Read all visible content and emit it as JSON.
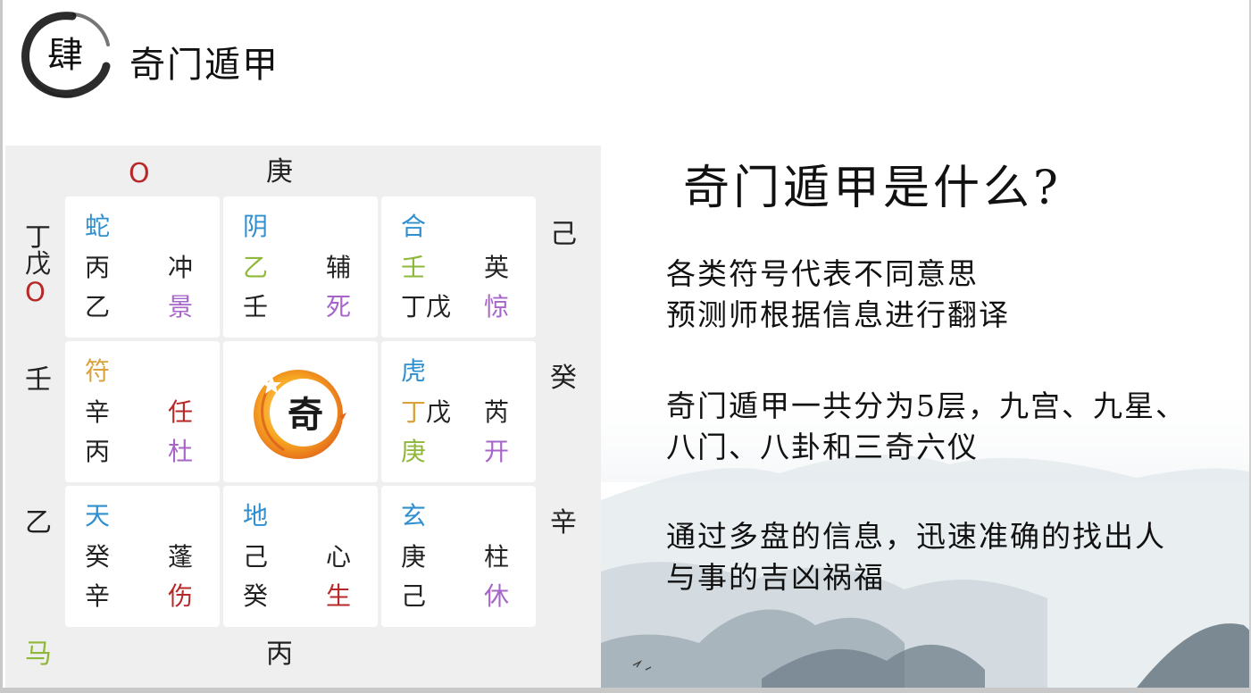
{
  "header": {
    "logo_char": "肆",
    "title": "奇门遁甲"
  },
  "board": {
    "top_left_marker": "O",
    "top_center": "庚",
    "left_top": [
      "丁",
      "戊",
      "O"
    ],
    "left_mid": "壬",
    "left_bottom": "乙",
    "right_top": "己",
    "right_mid": "癸",
    "right_bottom": "辛",
    "bottom_center": "丙",
    "bottom_left_marker": "马",
    "center_logo_char": "奇",
    "palaces": [
      {
        "god": "蛇",
        "s1": "丙",
        "s2": "乙",
        "r1": "冲",
        "r2": "景"
      },
      {
        "god": "阴",
        "s1": "乙",
        "s2": "壬",
        "r1": "辅",
        "r2": "死"
      },
      {
        "god": "合",
        "s1": "壬",
        "s2": "丁戊",
        "r1": "英",
        "r2": "惊"
      },
      {
        "god": "符",
        "s1": "辛",
        "s2": "丙",
        "r1": "任",
        "r2": "杜"
      },
      {
        "god": "虎",
        "s1a": "丁",
        "s1b": "戊",
        "s2": "庚",
        "r1": "芮",
        "r2": "开"
      },
      {
        "god": "天",
        "s1": "癸",
        "s2": "辛",
        "r1": "蓬",
        "r2": "伤"
      },
      {
        "god": "地",
        "s1": "己",
        "s2": "癸",
        "r1": "心",
        "r2": "生"
      },
      {
        "god": "玄",
        "s1": "庚",
        "s2": "己",
        "r1": "柱",
        "r2": "休"
      }
    ]
  },
  "info": {
    "title": "奇门遁甲是什么?",
    "p1": [
      "各类符号代表不同意思",
      "预测师根据信息进行翻译"
    ],
    "p2": [
      "奇门遁甲一共分为5层，九宫、九星、",
      "八门、八卦和三奇六仪"
    ],
    "p3": [
      "通过多盘的信息，迅速准确的找出人",
      "与事的吉凶祸福"
    ]
  },
  "colors": {
    "god_blue": "#2f8fcf",
    "red": "#b72828",
    "purple": "#a765c9",
    "green": "#8fb83a",
    "gold": "#d9a23a",
    "board_bg": "#efefef"
  }
}
